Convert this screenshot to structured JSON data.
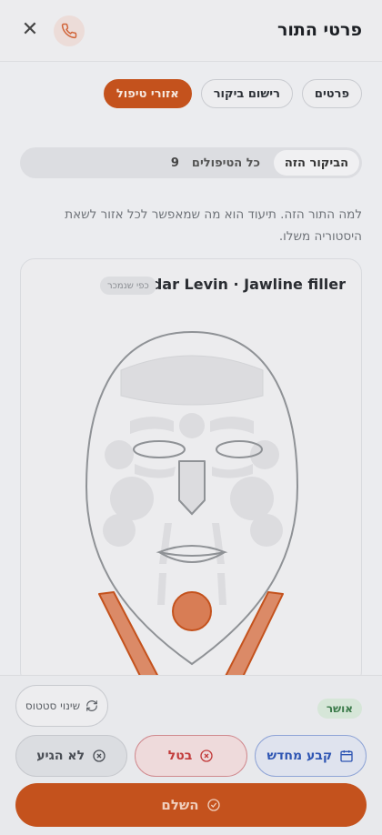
{
  "header": {
    "title": "פרטי התור"
  },
  "tabs": [
    {
      "label": "פרטים"
    },
    {
      "label": "רישום ביקור"
    },
    {
      "label": "אזורי טיפול"
    }
  ],
  "segment": {
    "active_label": "הביקור הזה",
    "other_label": "כל הטיפולים",
    "other_count": "9"
  },
  "description": "למה התור הזה. תיעוד הוא מה שמאפשר לכל אזור לשאת היסטוריה משלו.",
  "card": {
    "title": "Hadar Levin · Jawline filler",
    "badge": "כפי שנמכר"
  },
  "footer": {
    "status_badge": "אושר",
    "status_change": "שינוי סטטוס",
    "reschedule": "קבע מחדש",
    "cancel": "בטל",
    "no_show": "לא הגיע",
    "complete": "השלם"
  },
  "colors": {
    "accent": "#c4521d",
    "confirm": "#3b7a4a",
    "danger": "#c23b3b",
    "info": "#2f56b3"
  }
}
